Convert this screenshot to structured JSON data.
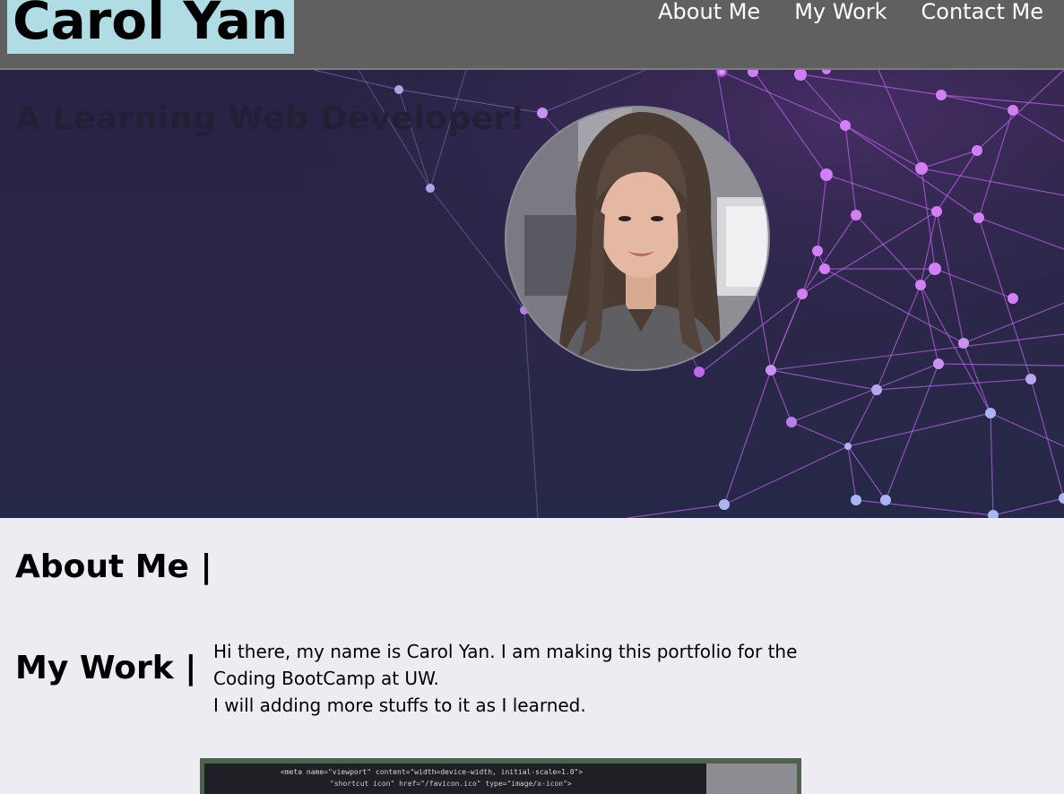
{
  "header": {
    "brand": "Carol Yan",
    "nav": [
      {
        "label": "About Me"
      },
      {
        "label": "My Work"
      },
      {
        "label": "Contact Me"
      }
    ]
  },
  "hero": {
    "tagline": "A Learning Web Developer!"
  },
  "about": {
    "heading": "About Me |",
    "line1": "Hi there, my name is Carol Yan. I am making this portfolio for the Coding BootCamp at UW.",
    "line2": "I will adding more stuffs to it as I learned."
  },
  "work": {
    "heading": "My Work |",
    "code_line1": "<meta name=\"viewport\" content=\"width=device-width, initial-scale=1.0\">",
    "code_line2": "\"shortcut icon\" href=\"/favicon.ico\" type=\"image/x-icon\">"
  },
  "colors": {
    "header_bg": "#606060",
    "brand_bg": "#b0dde3",
    "hero_bg": "#282344",
    "network_nodes": "#d27ef5",
    "page_bg": "#edecf2"
  }
}
